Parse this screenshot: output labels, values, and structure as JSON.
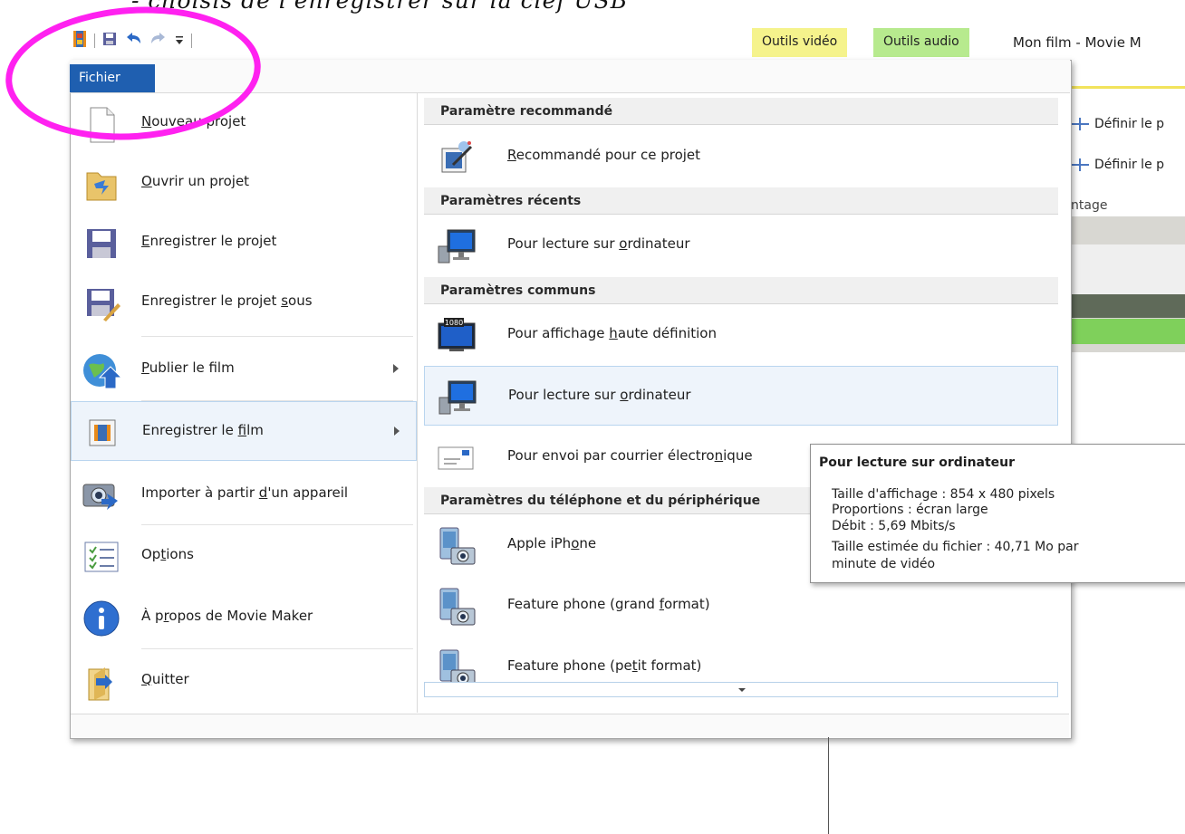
{
  "caption": "- choisis de l'enregistrer sur la clef USB",
  "window": {
    "title": "Mon film - Movie M",
    "contextual_tabs": [
      {
        "label": "Outils vidéo",
        "color": "#f5f38c"
      },
      {
        "label": "Outils audio",
        "color": "#b7ea8e"
      }
    ]
  },
  "ribbon": {
    "items": [
      "Définir le p",
      "Définir le p"
    ],
    "group_label": "ntage",
    "accent": "#f2e35c"
  },
  "file_tab": {
    "label": "Fichier",
    "color": "#1f5fb0"
  },
  "left_menu": [
    {
      "label": "Nouveau projet",
      "icon": "new-document-icon"
    },
    {
      "label": "Ouvrir un projet",
      "icon": "open-folder-icon"
    },
    {
      "label": "Enregistrer le projet",
      "icon": "save-disk-icon"
    },
    {
      "label": "Enregistrer le projet sous",
      "icon": "save-as-icon"
    },
    {
      "label": "Publier le film",
      "icon": "globe-upload-icon",
      "submenu": true
    },
    {
      "label": "Enregistrer le film",
      "icon": "film-save-icon",
      "submenu": true,
      "selected": true
    },
    {
      "label": "Importer à partir d'un appareil",
      "icon": "camera-import-icon"
    },
    {
      "label": "Options",
      "icon": "options-list-icon"
    },
    {
      "label": "À propos de Movie Maker",
      "icon": "info-icon"
    },
    {
      "label": "Quitter",
      "icon": "exit-icon"
    }
  ],
  "right_panel": {
    "sections": [
      {
        "header": "Paramètre recommandé",
        "items": [
          {
            "label": "Recommandé pour ce projet",
            "icon": "film-magic-icon"
          }
        ]
      },
      {
        "header": "Paramètres récents",
        "items": [
          {
            "label": "Pour lecture sur ordinateur",
            "icon": "computer-monitor-icon"
          }
        ]
      },
      {
        "header": "Paramètres communs",
        "items": [
          {
            "label": "Pour affichage haute définition",
            "icon": "hd-tv-icon"
          },
          {
            "label": "Pour lecture sur ordinateur",
            "icon": "computer-monitor-icon",
            "hovered": true
          },
          {
            "label": "Pour envoi par courrier électronique",
            "icon": "email-icon"
          }
        ]
      },
      {
        "header": "Paramètres du téléphone et du périphérique",
        "items": [
          {
            "label": "Apple iPhone",
            "icon": "phone-camera-icon"
          },
          {
            "label": "Feature phone (grand format)",
            "icon": "phone-camera-icon"
          },
          {
            "label": "Feature phone (petit format)",
            "icon": "phone-camera-icon"
          }
        ]
      }
    ],
    "hd_badge": "1080"
  },
  "tooltip": {
    "title": "Pour lecture sur ordinateur",
    "lines": [
      "Taille d'affichage : 854 x 480 pixels",
      "Proportions : écran large",
      "Débit : 5,69 Mbits/s",
      "Taille estimée du fichier : 40,71 Mo par",
      "minute de vidéo"
    ]
  },
  "annotation_color": "#ff21f0"
}
